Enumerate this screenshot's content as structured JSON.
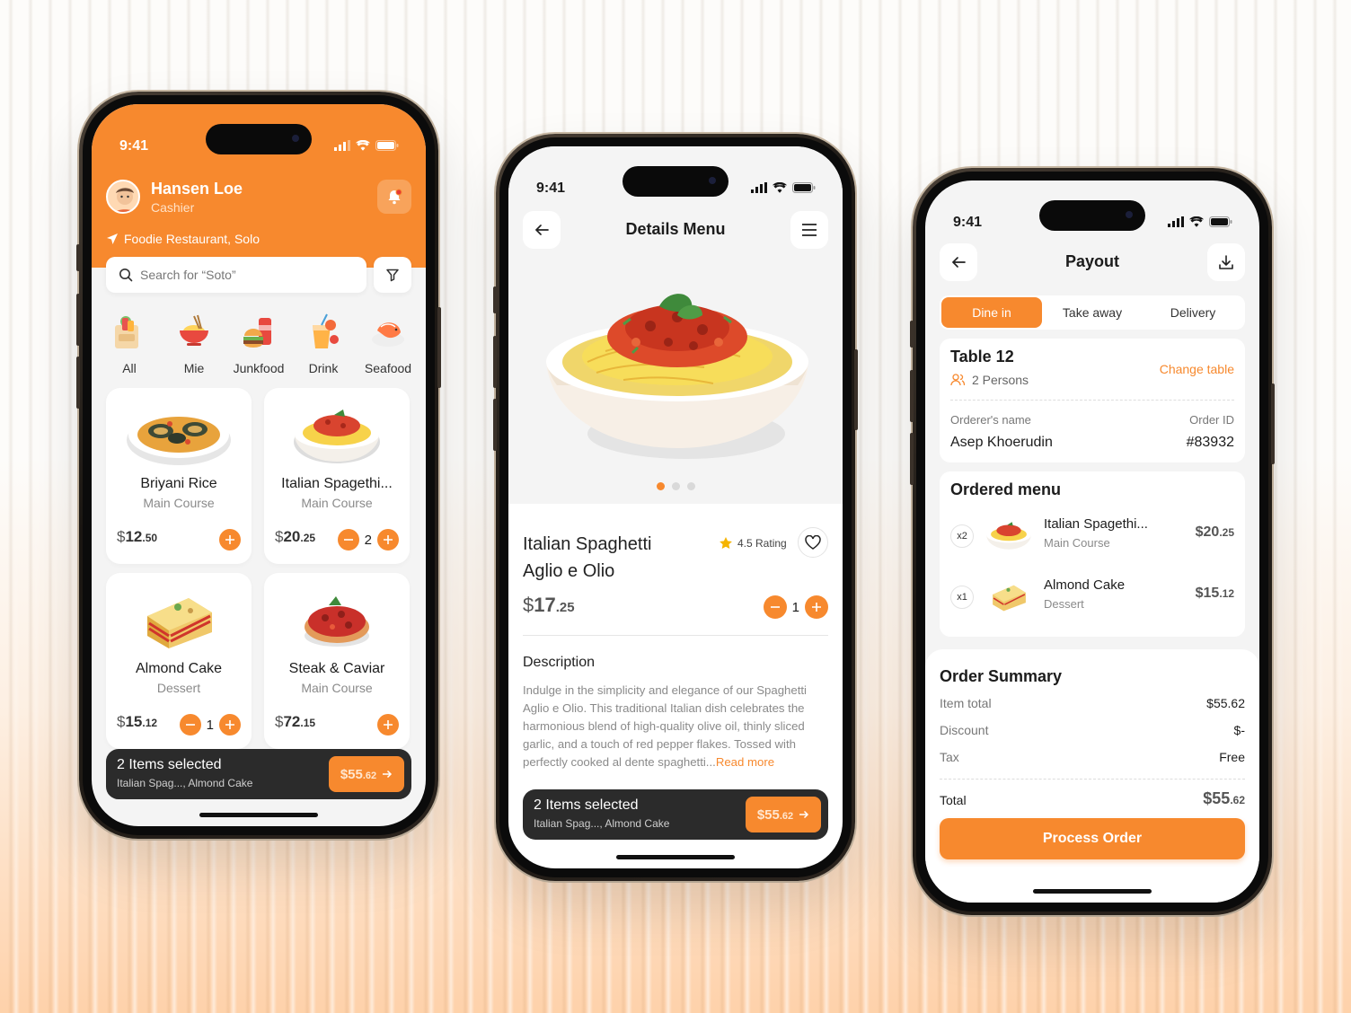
{
  "colors": {
    "accent": "#f7892e",
    "dark": "#2b2b2b",
    "text": "#1c1c1c",
    "muted": "#8a8a8a"
  },
  "phone1": {
    "time": "9:41",
    "user": {
      "name": "Hansen Loe",
      "role": "Cashier"
    },
    "location": "Foodie Restaurant, Solo",
    "search": {
      "placeholder": "Search for “Soto”"
    },
    "categories": [
      {
        "label": "All",
        "icon": "grocery-bag-icon"
      },
      {
        "label": "Mie",
        "icon": "noodle-bowl-icon"
      },
      {
        "label": "Junkfood",
        "icon": "burger-drink-icon"
      },
      {
        "label": "Drink",
        "icon": "juice-glass-icon"
      },
      {
        "label": "Seafood",
        "icon": "shrimp-icon"
      }
    ],
    "menu": [
      {
        "name": "Briyani Rice",
        "category": "Main Course",
        "price_main": "12",
        "price_cents": ".50",
        "qty": "",
        "icon": "briyani-rice-image"
      },
      {
        "name": "Italian Spagethi...",
        "category": "Main Course",
        "price_main": "20",
        "price_cents": ".25",
        "qty": "2",
        "icon": "spaghetti-image"
      },
      {
        "name": "Almond Cake",
        "category": "Dessert",
        "price_main": "15",
        "price_cents": ".12",
        "qty": "1",
        "icon": "almond-cake-image"
      },
      {
        "name": "Steak & Caviar",
        "category": "Main Course",
        "price_main": "72",
        "price_cents": ".15",
        "qty": "",
        "icon": "steak-caviar-image"
      }
    ],
    "selected": {
      "title": "2 Items selected",
      "items": "Italian Spag..., Almond Cake",
      "total_main": "$55",
      "total_cents": ".62"
    }
  },
  "phone2": {
    "time": "9:41",
    "title": "Details Menu",
    "dish": {
      "name_line1": "Italian Spaghetti",
      "name_line2": "Aglio e Olio",
      "rating": "4.5 Rating",
      "price_main": "17",
      "price_cents": ".25",
      "qty": "1"
    },
    "description": {
      "heading": "Description",
      "text": "Indulge in the simplicity and elegance of our Spaghetti Aglio e Olio. This traditional Italian dish celebrates the harmonious blend of high-quality olive oil, thinly sliced garlic, and a touch of red pepper flakes. Tossed with perfectly cooked al dente spaghetti...",
      "read_more": "Read more"
    },
    "selected": {
      "title": "2 Items selected",
      "items": "Italian Spag..., Almond Cake",
      "total_main": "$55",
      "total_cents": ".62"
    }
  },
  "phone3": {
    "time": "9:41",
    "title": "Payout",
    "tabs": [
      "Dine in",
      "Take away",
      "Delivery"
    ],
    "active_tab": 0,
    "table": {
      "name": "Table 12",
      "persons": "2 Persons",
      "change": "Change table"
    },
    "orderer": {
      "name_label": "Orderer's name",
      "name": "Asep Khoerudin",
      "id_label": "Order ID",
      "id": "#83932"
    },
    "ordered": {
      "heading": "Ordered menu",
      "items": [
        {
          "qty": "x2",
          "name": "Italian Spagethi...",
          "category": "Main Course",
          "price_main": "$20",
          "price_cents": ".25"
        },
        {
          "qty": "x1",
          "name": "Almond Cake",
          "category": "Dessert",
          "price_main": "$15",
          "price_cents": ".12"
        }
      ]
    },
    "summary": {
      "heading": "Order Summary",
      "item_total_label": "Item total",
      "item_total": "$55.62",
      "discount_label": "Discount",
      "discount": "$-",
      "tax_label": "Tax",
      "tax": "Free",
      "total_label": "Total",
      "total_main": "$55",
      "total_cents": ".62"
    },
    "process": "Process Order"
  }
}
